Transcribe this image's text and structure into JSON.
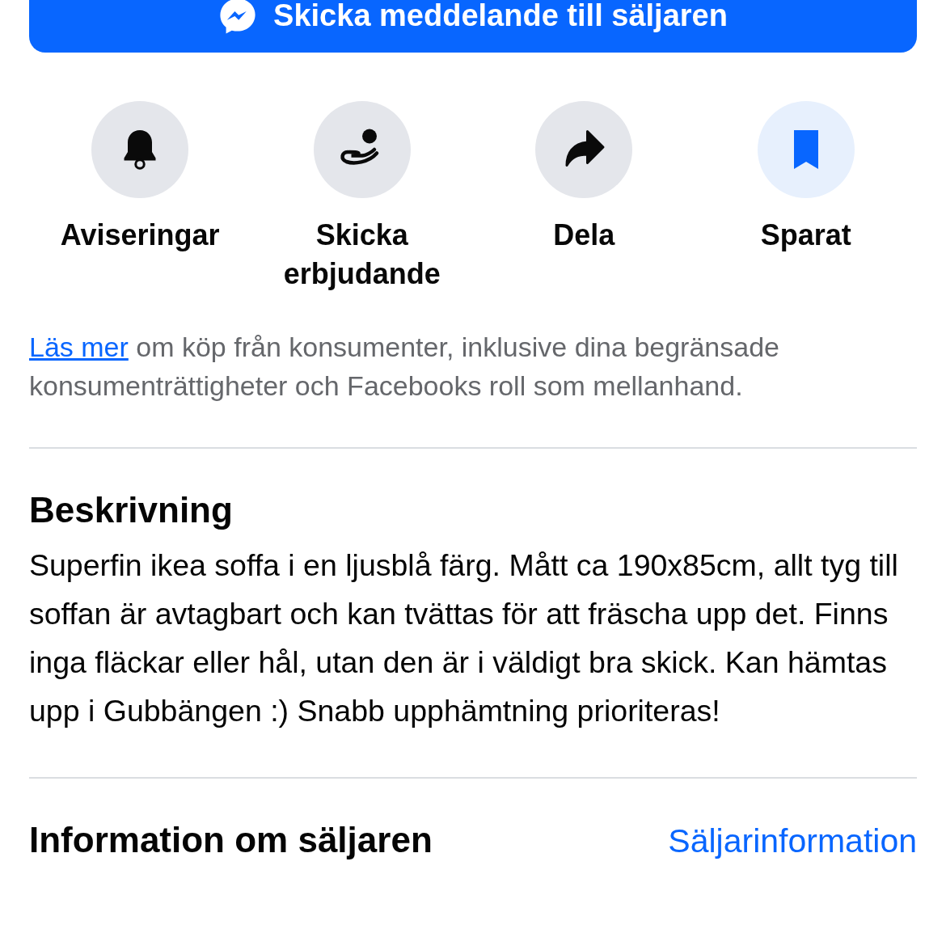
{
  "message_button": {
    "label": "Skicka meddelande till säljaren"
  },
  "actions": [
    {
      "kind": "bell",
      "label": "Aviseringar",
      "active": false
    },
    {
      "kind": "offer",
      "label": "Skicka erbjudande",
      "active": false
    },
    {
      "kind": "share",
      "label": "Dela",
      "active": false
    },
    {
      "kind": "bookmark",
      "label": "Sparat",
      "active": true
    }
  ],
  "notice": {
    "link": "Läs mer",
    "text": " om köp från konsumenter, inklusive dina begränsade konsumenträttigheter och Facebooks roll som mellanhand."
  },
  "description": {
    "title": "Beskrivning",
    "text": "Superfin ikea soffa i en ljusblå färg. Mått ca 190x85cm, allt tyg till soffan är avtagbart och kan tvättas för att fräscha upp det. Finns inga fläckar eller hål, utan den är i väldigt bra skick. Kan hämtas upp i Gubbängen :) Snabb upphämtning prioriteras!"
  },
  "seller": {
    "title": "Information om säljaren",
    "link": "Säljarinformation"
  }
}
